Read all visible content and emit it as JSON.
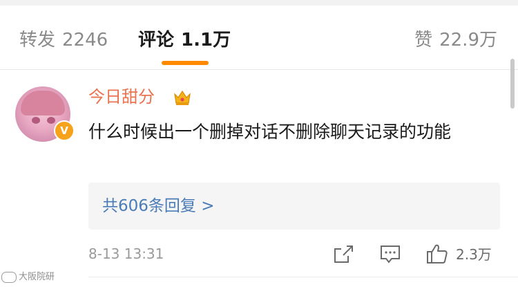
{
  "tabs": {
    "repost": {
      "label": "转发",
      "count": "2246"
    },
    "comments": {
      "label": "评论",
      "count": "1.1万"
    },
    "likes": {
      "label": "赞",
      "count": "22.9万"
    }
  },
  "comment": {
    "username": "今日甜分",
    "text": "什么时候出一个删掉对话不删除聊天记录的功能",
    "replies_label": "共606条回复 >",
    "timestamp": "8-13 13:31",
    "like_count": "2.3万"
  },
  "watermark": "大阪院研",
  "colors": {
    "accent_orange": "#ff8a00",
    "username": "#eb7350",
    "reply_link": "#4a7cb8",
    "muted_text": "#8a8a8a"
  },
  "icons": {
    "vip": "crown-vip-icon",
    "verified": "verified-badge-icon",
    "share": "share-icon",
    "reply": "comment-icon",
    "like": "thumbs-up-icon"
  }
}
